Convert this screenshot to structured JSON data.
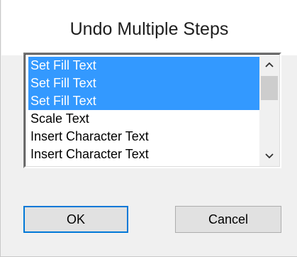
{
  "dialog": {
    "title": "Undo Multiple Steps"
  },
  "list": {
    "items": [
      {
        "label": "Set Fill Text",
        "selected": true
      },
      {
        "label": "Set Fill Text",
        "selected": true
      },
      {
        "label": "Set Fill Text",
        "selected": true
      },
      {
        "label": "Scale Text",
        "selected": false
      },
      {
        "label": "Insert Character Text",
        "selected": false
      },
      {
        "label": "Insert Character Text",
        "selected": false
      }
    ],
    "scroll_up_icon": "chevron-up-icon",
    "scroll_down_icon": "chevron-down-icon"
  },
  "buttons": {
    "ok_label": "OK",
    "cancel_label": "Cancel"
  },
  "colors": {
    "selection": "#3399ff",
    "default_button_border": "#0078d7"
  }
}
